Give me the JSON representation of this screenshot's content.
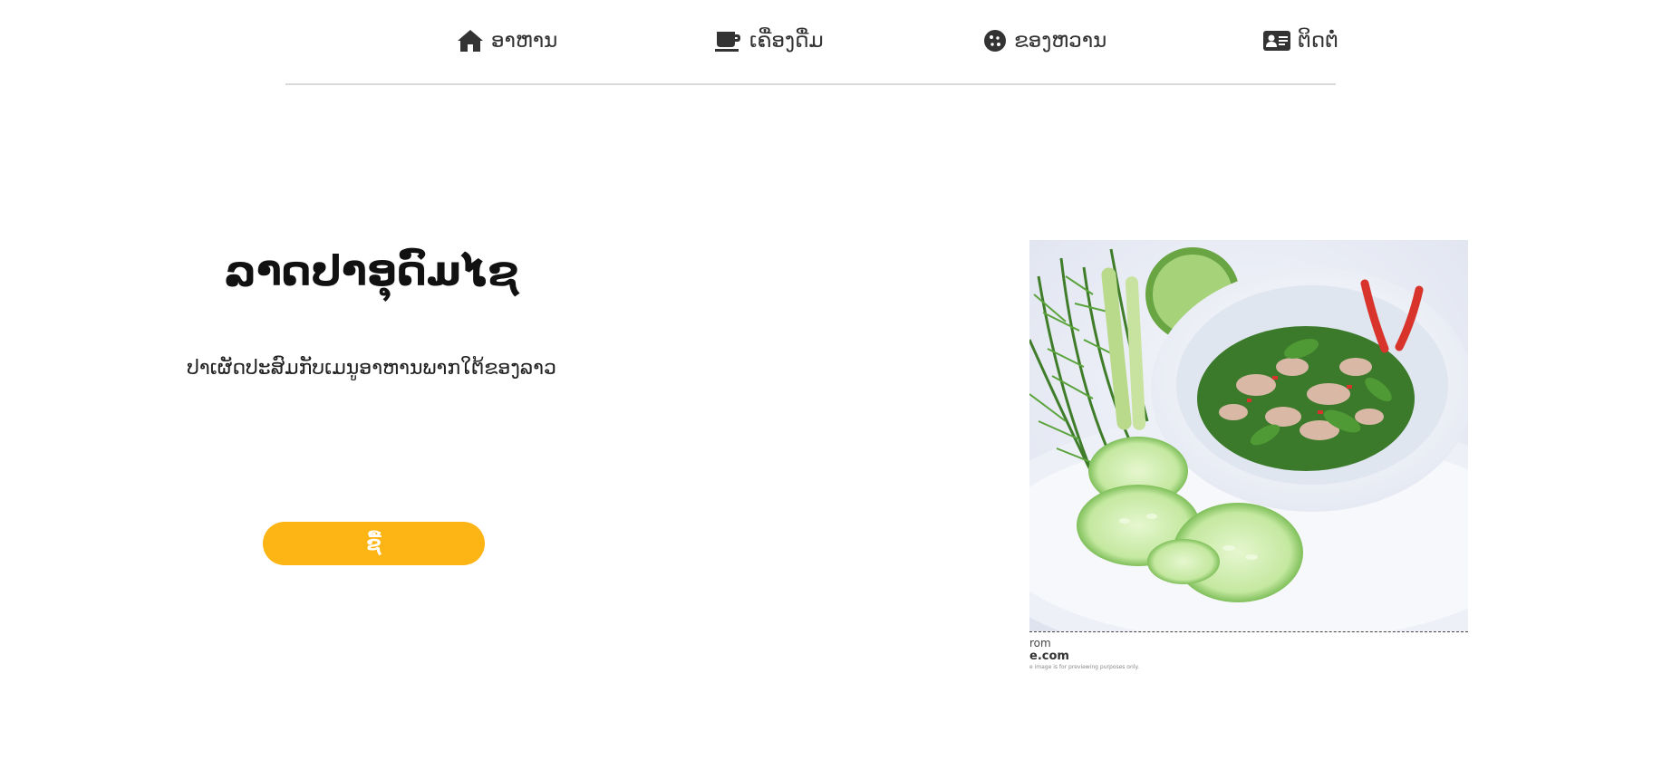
{
  "nav": {
    "items": [
      {
        "label": "ອາຫານ",
        "icon": "home-icon"
      },
      {
        "label": "ເຄື່ອງດື່ມ",
        "icon": "coffee-cup-icon"
      },
      {
        "label": "ຂອງຫວານ",
        "icon": "cookie-icon"
      },
      {
        "label": "ຕິດຕໍ່",
        "icon": "contact-card-icon"
      }
    ]
  },
  "hero": {
    "title": "ລາດປາອຸດົມໄຊ",
    "description": "ປາເຜັດປະສົມກັບເມນູອາຫານພາກໃຕ້ຂອງລາວ",
    "buy_label": "ຊື້"
  },
  "product_image": {
    "stock_line1": "rom",
    "stock_line2": "e.com",
    "stock_line3": "e image is for previewing purposes only."
  },
  "colors": {
    "accent": "#fdb515",
    "text": "#222222",
    "divider": "#d9d9d9"
  }
}
